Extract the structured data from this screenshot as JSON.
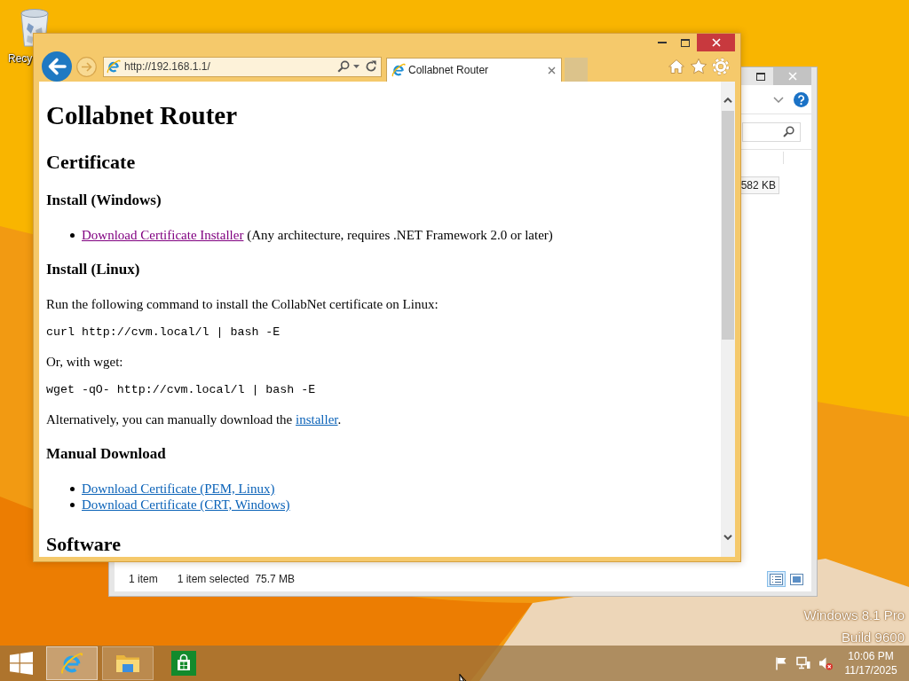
{
  "desktop": {
    "icons": [
      {
        "kind": "recycle_bin",
        "label": "Recy"
      }
    ],
    "watermark": [
      "Windows 8.1 Pro",
      "Build 9600"
    ]
  },
  "explorer_window": {
    "file_rows": [
      {
        "size": "582 KB",
        "selected": true
      }
    ],
    "status_bar": {
      "item_count": "1 item",
      "selection": "1 item selected",
      "selection_size": "75.7 MB"
    },
    "view_buttons": [
      {
        "kind": "details",
        "selected": true
      },
      {
        "kind": "large_icons",
        "selected": false
      }
    ]
  },
  "browser_window": {
    "address": "http://192.168.1.1/",
    "tabs": [
      {
        "title": "Collabnet Router",
        "selected": true
      }
    ],
    "content": [
      {
        "kind": "h1",
        "text": "Collabnet Router"
      },
      {
        "kind": "h2",
        "text": "Certificate"
      },
      {
        "kind": "h3",
        "text": "Install (Windows)"
      },
      {
        "kind": "list",
        "items": [
          {
            "link": "Download Certificate Installer",
            "visited": true,
            "after": " (Any architecture, requires .NET Framework 2.0 or later)"
          }
        ]
      },
      {
        "kind": "h3",
        "text": "Install (Linux)"
      },
      {
        "kind": "p",
        "text": "Run the following command to install the CollabNet certificate on Linux:"
      },
      {
        "kind": "code",
        "text": "curl http://cvm.local/l | bash -E"
      },
      {
        "kind": "p",
        "text": "Or, with wget:"
      },
      {
        "kind": "code",
        "text": "wget -qO- http://cvm.local/l | bash -E"
      },
      {
        "kind": "p",
        "text": "Alternatively, you can manually download the ",
        "link": "installer",
        "visited": false,
        "after": "."
      },
      {
        "kind": "h3",
        "text": "Manual Download"
      },
      {
        "kind": "list",
        "items": [
          {
            "link": "Download Certificate (PEM, Linux)",
            "visited": false
          },
          {
            "link": "Download Certificate (CRT, Windows)",
            "visited": false
          }
        ]
      },
      {
        "kind": "h2",
        "text": "Software"
      }
    ]
  },
  "taskbar": {
    "apps": [
      {
        "kind": "internet_explorer",
        "running": true,
        "selected": true
      },
      {
        "kind": "file_explorer",
        "running": true,
        "selected": false
      },
      {
        "kind": "store",
        "running": false,
        "selected": false
      }
    ],
    "tray": {
      "volume_muted": true,
      "time": "10:06 PM",
      "date": "11/17/2025"
    }
  }
}
